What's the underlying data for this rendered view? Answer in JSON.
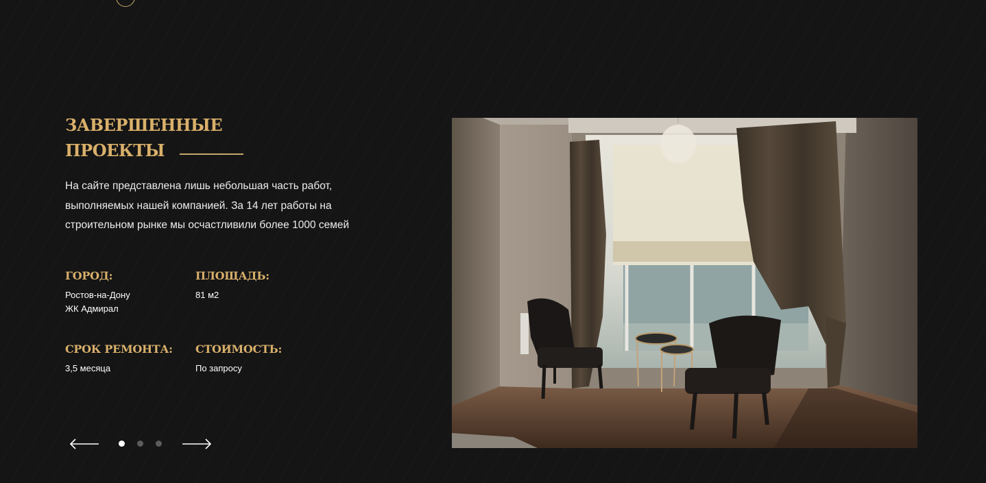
{
  "section": {
    "title_line1": "ЗАВЕРШЕННЫЕ",
    "title_line2": "ПРОЕКТЫ",
    "description": "На сайте представлена лишь небольшая часть работ, выполняемых нашей компанией. За 14 лет работы на строительном рынке мы осчастливили более 1000 семей"
  },
  "specs": {
    "city_label": "ГОРОД:",
    "city_value_line1": "Ростов-на-Дону",
    "city_value_line2": "ЖК Адмирал",
    "area_label": "ПЛОЩАДЬ:",
    "area_value": "81 м2",
    "duration_label": "СРОК РЕМОНТА:",
    "duration_value": "3,5 месяца",
    "price_label": "СТОИМОСТЬ:",
    "price_value": "По запросу"
  },
  "slider": {
    "slide_count": 3,
    "active_slide": 1,
    "prev_icon": "arrow-left-icon",
    "next_icon": "arrow-right-icon"
  },
  "colors": {
    "background": "#151516",
    "accent_gold": "#d9b06a",
    "text": "#ededed"
  }
}
